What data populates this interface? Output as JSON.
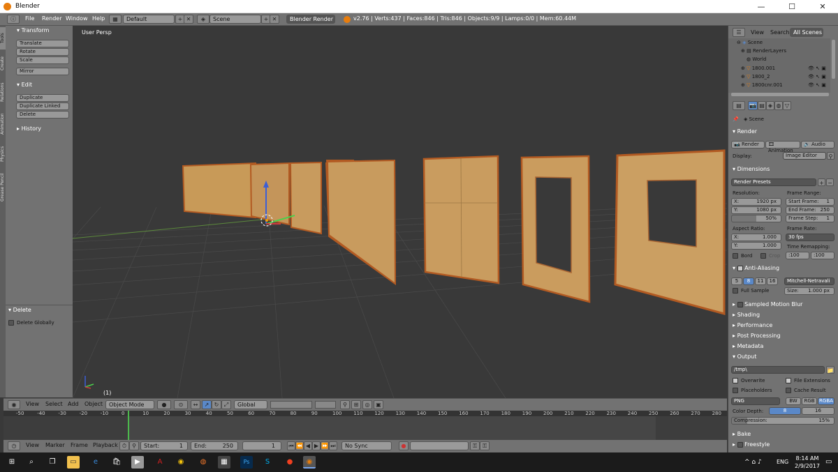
{
  "window": {
    "title": "Blender",
    "min": "—",
    "max": "☐",
    "close": "✕"
  },
  "menubar": {
    "items": [
      "File",
      "Render",
      "Window",
      "Help"
    ],
    "layout": "Default",
    "scene": "Scene",
    "engine": "Blender Render",
    "stats": "v2.76 | Verts:437 | Faces:846 | Tris:846 | Objects:9/9 | Lamps:0/0 | Mem:60.44M"
  },
  "toolshelf": {
    "tabs": [
      "Tools",
      "Create",
      "Relations",
      "Animation",
      "Physics",
      "Grease Pencil"
    ],
    "transform_header": "Transform",
    "transform": [
      "Translate",
      "Rotate",
      "Scale"
    ],
    "mirror": "Mirror",
    "edit_header": "Edit",
    "edit": [
      "Duplicate",
      "Duplicate Linked",
      "Delete"
    ],
    "history_header": "History",
    "delete_header": "Delete",
    "delete_globally": "Delete Globally"
  },
  "viewport": {
    "label": "User Persp",
    "frame_label": "(1)"
  },
  "vp_header": {
    "items": [
      "View",
      "Select",
      "Add",
      "Object"
    ],
    "mode": "Object Mode",
    "orientation": "Global"
  },
  "timeline": {
    "ticks": [
      "-50",
      "-40",
      "-30",
      "-20",
      "-10",
      "0",
      "10",
      "20",
      "30",
      "40",
      "50",
      "60",
      "70",
      "80",
      "90",
      "100",
      "110",
      "120",
      "130",
      "140",
      "150",
      "160",
      "170",
      "180",
      "190",
      "200",
      "210",
      "220",
      "230",
      "240",
      "250",
      "260",
      "270",
      "280"
    ]
  },
  "tl_bar": {
    "items": [
      "View",
      "Marker",
      "Frame",
      "Playback"
    ],
    "start_label": "Start:",
    "start_value": "1",
    "end_label": "End:",
    "end_value": "250",
    "current": "1",
    "sync": "No Sync"
  },
  "outliner": {
    "menu": [
      "View",
      "Search",
      "All Scenes"
    ],
    "items": [
      "Scene",
      "RenderLayers",
      "World",
      "1800.001",
      "1800_2",
      "1800cnr.001"
    ]
  },
  "props": {
    "scene": "Scene",
    "render_header": "Render",
    "render_btns": [
      "Render",
      "Animation",
      "Audio"
    ],
    "display_label": "Display:",
    "display_value": "Image Editor",
    "dimensions_header": "Dimensions",
    "render_presets": "Render Presets",
    "resolution_label": "Resolution:",
    "res_x": "X:",
    "res_x_val": "1920 px",
    "res_y": "Y:",
    "res_y_val": "1080 px",
    "res_pct": "50%",
    "frame_range_label": "Frame Range:",
    "start_frame": "Start Frame:",
    "start_frame_val": "1",
    "end_frame": "End Frame:",
    "end_frame_val": "250",
    "frame_step": "Frame Step:",
    "frame_step_val": "1",
    "aspect_label": "Aspect Ratio:",
    "asp_x": "X:",
    "asp_x_val": "1.000",
    "asp_y": "Y:",
    "asp_y_val": "1.000",
    "frame_rate_label": "Frame Rate:",
    "fps": "30 fps",
    "time_remap_label": "Time Remapping:",
    "remap_old": ":100",
    "remap_new": ":100",
    "bord": "Bord",
    "crop": "Crop",
    "aa_header": "Anti-Aliasing",
    "aa_samples": [
      "5",
      "8",
      "11",
      "16"
    ],
    "aa_filter": "Mitchell-Netravali",
    "full_sample": "Full Sample",
    "size_label": "Size:",
    "size_val": "1.000 px",
    "collapsed": [
      "Sampled Motion Blur",
      "Shading",
      "Performance",
      "Post Processing",
      "Metadata"
    ],
    "output_header": "Output",
    "output_path": "/tmp\\",
    "overwrite": "Overwrite",
    "file_ext": "File Extensions",
    "placeholders": "Placeholders",
    "cache_result": "Cache Result",
    "format": "PNG",
    "color_modes": [
      "BW",
      "RGB",
      "RGBA"
    ],
    "color_depth_label": "Color Depth:",
    "depth_8": "8",
    "depth_16": "16",
    "compression_label": "Compression:",
    "compression_val": "15%",
    "bake": "Bake",
    "freestyle": "Freestyle"
  },
  "taskbar": {
    "time": "8:14 AM",
    "date": "2/9/2017",
    "lang": "ENG",
    "apps": [
      "search-icon",
      "task-view-icon",
      "file-explorer-icon",
      "edge-icon",
      "store-icon",
      "media-icon",
      "acrobat-icon",
      "chrome-icon",
      "firefox-icon",
      "calculator-icon",
      "photoshop-icon",
      "skype-icon",
      "app-icon",
      "blender-icon"
    ]
  }
}
